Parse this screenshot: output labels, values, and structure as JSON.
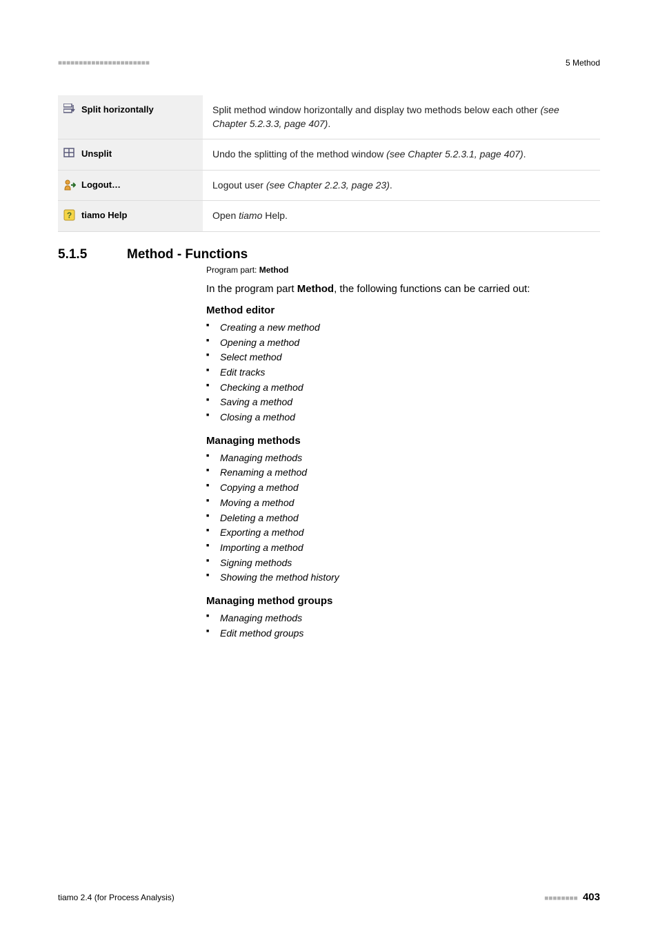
{
  "header": {
    "dots": "■■■■■■■■■■■■■■■■■■■■■■",
    "title": "5 Method"
  },
  "rows": [
    {
      "label": "Split horizontally",
      "desc_pre": "Split method window horizontally and display two methods below each other ",
      "desc_em": "(see Chapter 5.2.3.3, page 407)",
      "desc_post": "."
    },
    {
      "label": "Unsplit",
      "desc_pre": "Undo the splitting of the method window ",
      "desc_em": "(see Chapter 5.2.3.1, page 407)",
      "desc_post": "."
    },
    {
      "label": "Logout…",
      "desc_pre": "Logout user ",
      "desc_em": "(see Chapter 2.2.3, page 23)",
      "desc_post": "."
    },
    {
      "label": "tiamo Help",
      "desc_pre": "Open ",
      "desc_em": "tiamo",
      "desc_post": " Help."
    }
  ],
  "section": {
    "num": "5.1.5",
    "title": "Method - Functions",
    "program_label": "Program part: ",
    "program_value": "Method",
    "intro_pre": "In the program part ",
    "intro_bold": "Method",
    "intro_post": ", the following functions can be carried out:",
    "groups": [
      {
        "title": "Method editor",
        "items": [
          "Creating a new method",
          "Opening a method",
          "Select method",
          "Edit tracks",
          "Checking a method",
          "Saving a method",
          "Closing a method"
        ]
      },
      {
        "title": "Managing methods",
        "items": [
          "Managing methods",
          "Renaming a method",
          "Copying a method",
          "Moving a method",
          "Deleting a method",
          "Exporting a method",
          "Importing a method",
          "Signing methods",
          "Showing the method history"
        ]
      },
      {
        "title": "Managing method groups",
        "items": [
          "Managing methods",
          "Edit method groups"
        ]
      }
    ]
  },
  "footer": {
    "left": "tiamo 2.4 (for Process Analysis)",
    "dots": "■■■■■■■■",
    "page": "403"
  }
}
